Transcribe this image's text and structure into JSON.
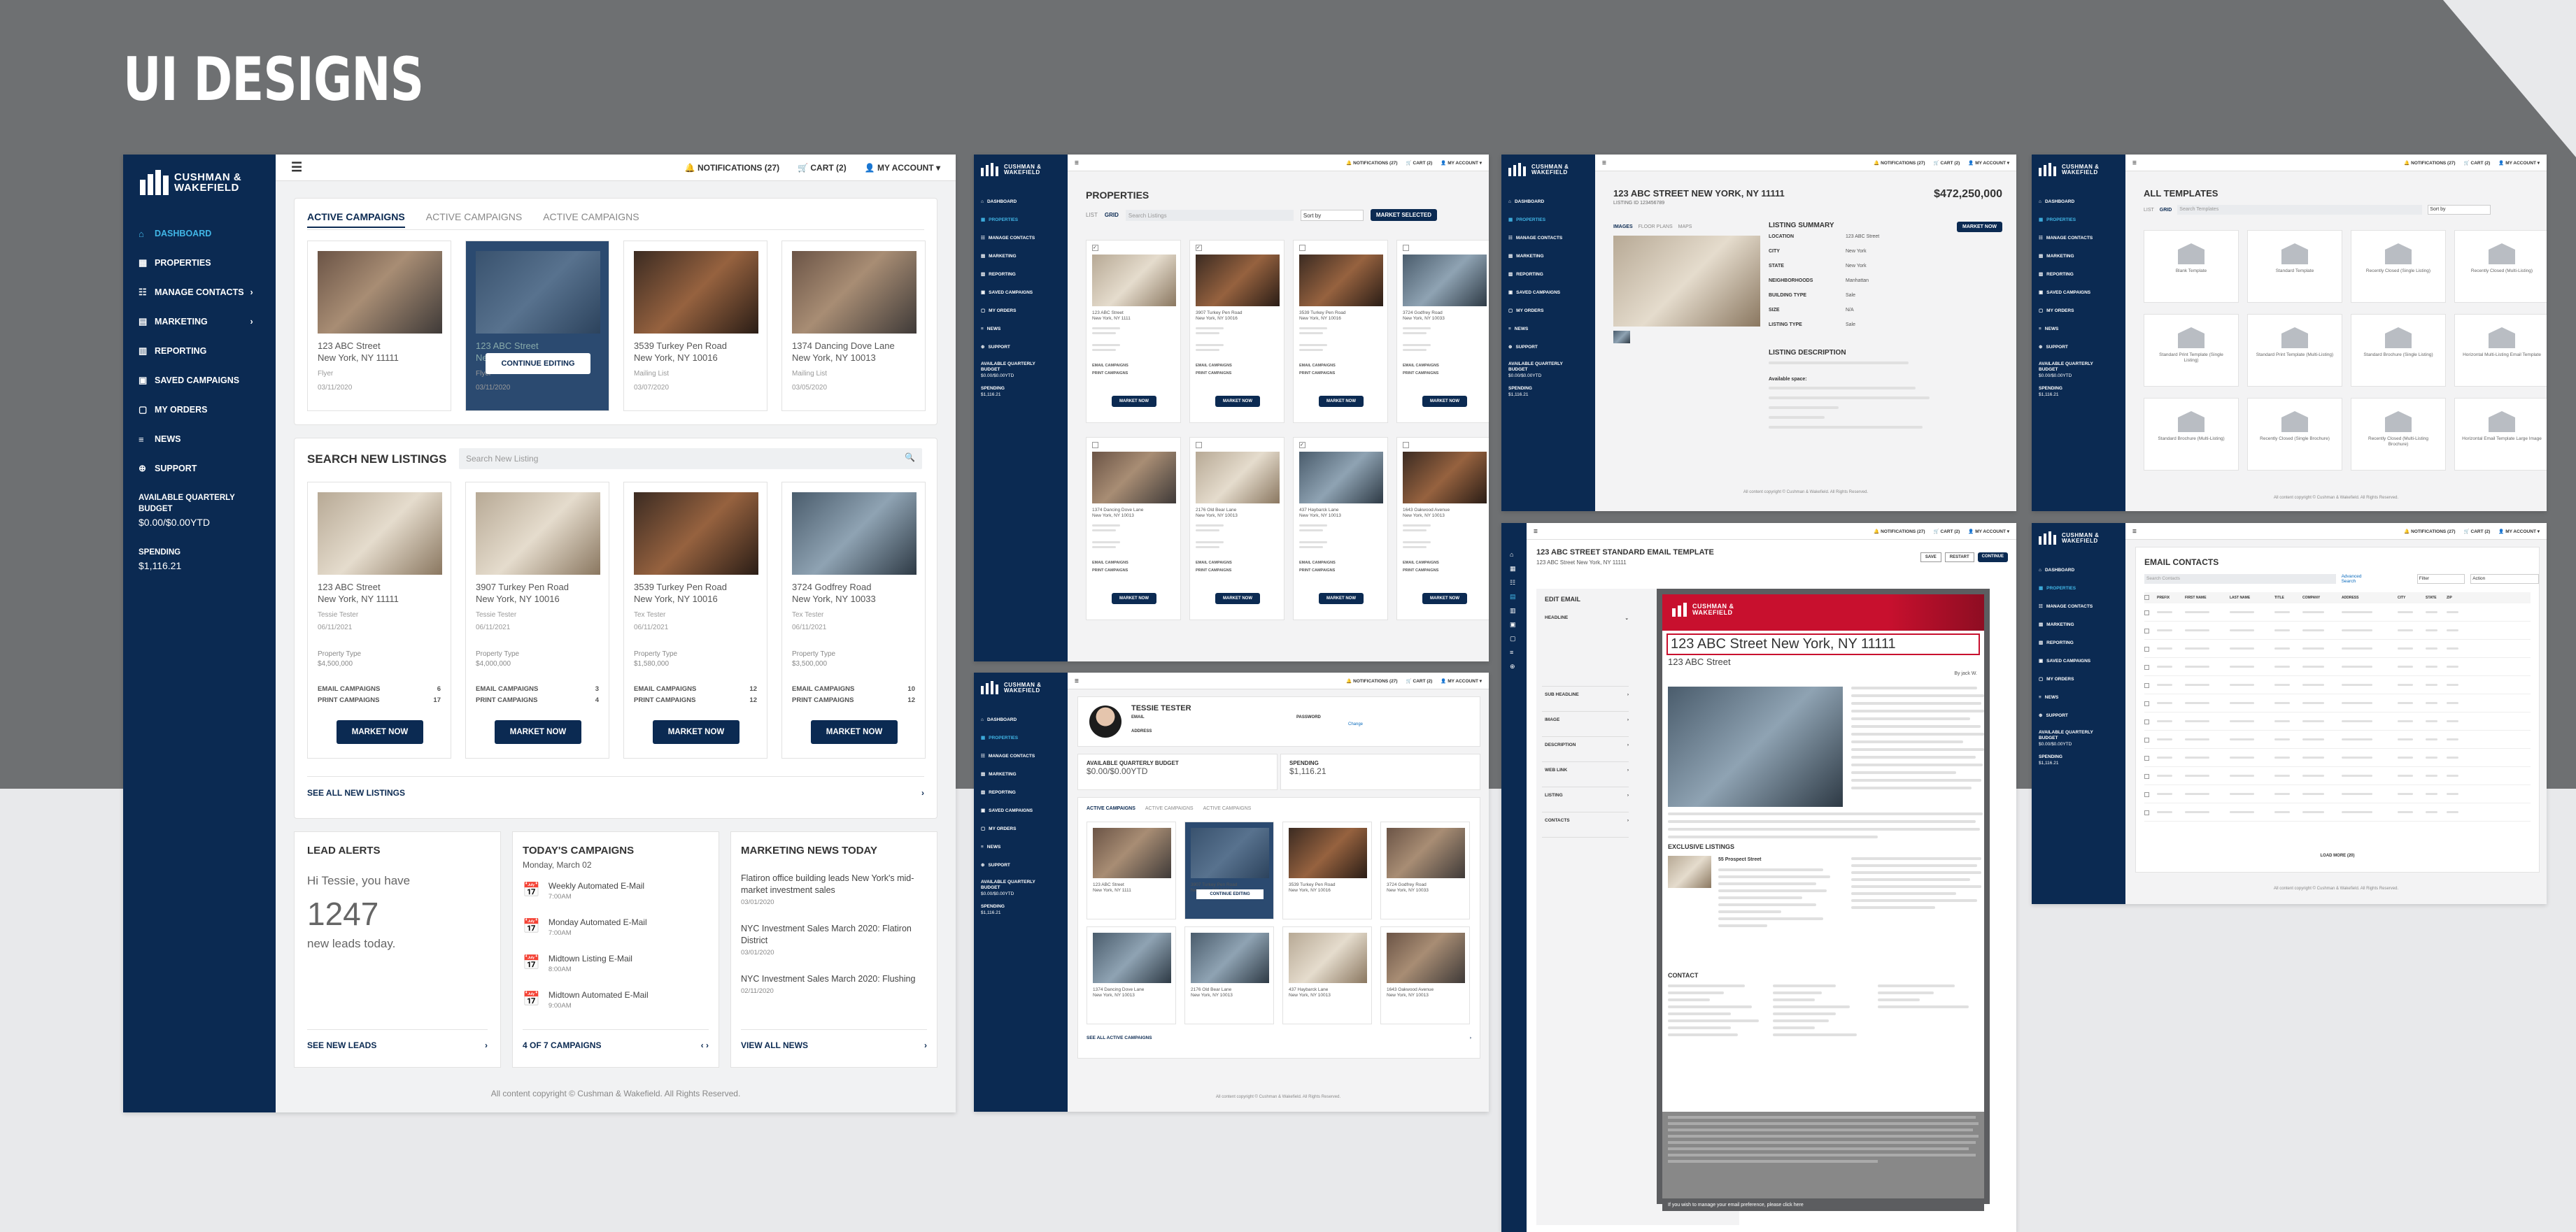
{
  "heading": "UI DESIGNS",
  "brand": {
    "line1": "CUSHMAN &",
    "line2": "WAKEFIELD"
  },
  "nav": [
    "DASHBOARD",
    "PROPERTIES",
    "MANAGE CONTACTS",
    "MARKETING",
    "REPORTING",
    "SAVED CAMPAIGNS",
    "MY ORDERS",
    "NEWS",
    "SUPPORT"
  ],
  "budget": {
    "label1": "AVAILABLE QUARTERLY",
    "label2": "BUDGET",
    "value": "$0.00/$0.00YTD",
    "spending_label": "SPENDING",
    "spending": "$1,116.21"
  },
  "topbar": {
    "notifications": "NOTIFICATIONS (27)",
    "cart": "CART (2)",
    "account": "MY ACCOUNT"
  },
  "dashboard": {
    "tabs": [
      "ACTIVE CAMPAIGNS",
      "ACTIVE CAMPAIGNS",
      "ACTIVE CAMPAIGNS"
    ],
    "campaigns": [
      {
        "addr1": "123 ABC Street",
        "addr2": "New York, NY 11111",
        "type": "Flyer",
        "date": "03/11/2020"
      },
      {
        "addr1": "123 ABC Street",
        "addr2": "New York, NY 11111",
        "type": "Flyer",
        "date": "03/11/2020",
        "overlay": "CONTINUE EDITING"
      },
      {
        "addr1": "3539 Turkey Pen Road",
        "addr2": "New York, NY 10016",
        "type": "Mailing List",
        "date": "03/07/2020"
      },
      {
        "addr1": "1374 Dancing Dove Lane",
        "addr2": "New York, NY 10013",
        "type": "Mailing List",
        "date": "03/05/2020"
      }
    ],
    "search_title": "SEARCH NEW LISTINGS",
    "search_placeholder": "Search New Listing",
    "listings": [
      {
        "addr1": "123 ABC Street",
        "addr2": "New York, NY 11111",
        "agent": "Tessie Tester",
        "date": "06/11/2021",
        "ptype_label": "Property Type",
        "ptype": "$4,500,000",
        "email_label": "EMAIL CAMPAIGNS",
        "email": "6",
        "print_label": "PRINT CAMPAIGNS",
        "print": "17"
      },
      {
        "addr1": "3907 Turkey Pen Road",
        "addr2": "New York, NY 10016",
        "agent": "Tessie Tester",
        "date": "06/11/2021",
        "ptype_label": "Property Type",
        "ptype": "$4,000,000",
        "email_label": "EMAIL CAMPAIGNS",
        "email": "3",
        "print_label": "PRINT CAMPAIGNS",
        "print": "4"
      },
      {
        "addr1": "3539 Turkey Pen Road",
        "addr2": "New York, NY 10016",
        "agent": "Tex Tester",
        "date": "06/11/2021",
        "ptype_label": "Property Type",
        "ptype": "$1,580,000",
        "email_label": "EMAIL CAMPAIGNS",
        "email": "12",
        "print_label": "PRINT CAMPAIGNS",
        "print": "12"
      },
      {
        "addr1": "3724 Godfrey Road",
        "addr2": "New York, NY 10033",
        "agent": "Tex Tester",
        "date": "06/11/2021",
        "ptype_label": "Property Type",
        "ptype": "$3,500,000",
        "email_label": "EMAIL CAMPAIGNS",
        "email": "10",
        "print_label": "PRINT CAMPAIGNS",
        "print": "12"
      }
    ],
    "market_now": "MARKET NOW",
    "see_all": "SEE ALL NEW LISTINGS",
    "lead": {
      "title": "LEAD ALERTS",
      "greet": "Hi Tessie, you have",
      "count": "1247",
      "sub": "new leads today.",
      "link": "SEE NEW LEADS"
    },
    "today": {
      "title": "TODAY'S CAMPAIGNS",
      "date": "Monday, March 02",
      "items": [
        {
          "name": "Weekly Automated E-Mail",
          "time": "7:00AM"
        },
        {
          "name": "Monday Automated E-Mail",
          "time": "7:00AM"
        },
        {
          "name": "Midtown Listing E-Mail",
          "time": "8:00AM"
        },
        {
          "name": "Midtown Automated E-Mail",
          "time": "9:00AM"
        }
      ],
      "pager": "4 OF 7 CAMPAIGNS"
    },
    "news": {
      "title": "MARKETING NEWS TODAY",
      "items": [
        {
          "title": "Flatiron office building leads New York's mid-market investment sales",
          "date": "03/01/2020"
        },
        {
          "title": "NYC Investment Sales March 2020: Flatiron District",
          "date": "03/01/2020"
        },
        {
          "title": "NYC Investment Sales March 2020: Flushing",
          "date": "02/11/2020"
        }
      ],
      "link": "VIEW ALL NEWS"
    },
    "footer": "All content copyright © Cushman & Wakefield. All Rights Reserved."
  },
  "properties": {
    "title": "PROPERTIES",
    "list": "LIST",
    "grid": "GRID",
    "search": "Search Listings",
    "sort": "Sort by",
    "market_selected": "MARKET SELECTED",
    "items": [
      {
        "a": "123 ABC Street",
        "b": "New York, NY 1111"
      },
      {
        "a": "3907 Turkey Pen Road",
        "b": "New York, NY 10016"
      },
      {
        "a": "3539 Turkey Pen Road",
        "b": "New York, NY 10016"
      },
      {
        "a": "3724 Godfrey Road",
        "b": "New York, NY 10033"
      },
      {
        "a": "1374 Dancing Dove Lane",
        "b": "New York, NY 10013"
      },
      {
        "a": "2176 Old Bear Lane",
        "b": "New York, NY 10013"
      },
      {
        "a": "437 Haybarck Lane",
        "b": "New York, NY 10013"
      },
      {
        "a": "1643 Oakwood Avenue",
        "b": "New York, NY 10013"
      }
    ]
  },
  "detail": {
    "title": "123 ABC STREET NEW YORK, NY 11111",
    "listing_id": "LISTING ID 123456789",
    "price": "$472,250,000",
    "tabs": [
      "IMAGES",
      "FLOOR PLANS",
      "MAPS"
    ],
    "summary_title": "LISTING SUMMARY",
    "rows": [
      [
        "LOCATION",
        "123 ABC Street"
      ],
      [
        "CITY",
        "New York"
      ],
      [
        "STATE",
        "New York"
      ],
      [
        "NEIGHBORHOODS",
        "Manhattan"
      ],
      [
        "BUILDING TYPE",
        "Sale"
      ],
      [
        "SIZE",
        "N/A"
      ],
      [
        "LISTING TYPE",
        "Sale"
      ]
    ],
    "desc_title": "LISTING DESCRIPTION",
    "available": "Available space:"
  },
  "templates": {
    "title": "ALL TEMPLATES",
    "search": "Search Templates",
    "sort": "Sort by",
    "items": [
      "Blank Template",
      "Standard Template",
      "Recently Closed (Single Listing)",
      "Recently Closed (Multi-Listing)",
      "Standard Print Template (Single Listing)",
      "Standard Print Template (Multi-Listing)",
      "Standard Brochure (Single Listing)",
      "Horizontal Multi-Listing Email Template",
      "Standard Brochure (Multi-Listing)",
      "Recently Closed (Single Brochure)",
      "Recently Closed (Multi-Listing Brochure)",
      "Horizontal Email Template Large Image"
    ]
  },
  "profile": {
    "name": "TESSIE TESTER",
    "email_label": "EMAIL",
    "password_label": "PASSWORD",
    "change": "Change",
    "address_label": "ADDRESS",
    "budget_label": "AVAILABLE QUARTERLY BUDGET",
    "budget": "$0.00/$0.00YTD",
    "spending_label": "SPENDING",
    "spending": "$1,116.21",
    "see_all": "SEE ALL ACTIVE CAMPAIGNS"
  },
  "email_tpl": {
    "title": "123 ABC STREET STANDARD EMAIL TEMPLATE",
    "sub": "123 ABC Street New York, NY 11111",
    "save": "SAVE",
    "restart": "RESTART",
    "continue": "CONTINUE",
    "edit": "EDIT EMAIL",
    "sections": [
      "HEADLINE",
      "SUB HEADLINE",
      "IMAGE",
      "DESCRIPTION",
      "WEB LINK",
      "LISTING",
      "CONTACTS"
    ],
    "preview_head": "123 ABC Street New York, NY 11111",
    "preview_sub": "123 ABC Street",
    "by": "By jack W.",
    "exclusive": "EXCLUSIVE LISTINGS",
    "prospect": "55 Prospect Street",
    "contact": "CONTACT",
    "manage": "If you wish to manage your email preference, please click here"
  },
  "contacts": {
    "title": "EMAIL CONTACTS",
    "search": "Search Contacts",
    "advanced": "Advanced Search",
    "filter": "Filter",
    "action": "Action",
    "cols": [
      "PREFIX",
      "FIRST NAME",
      "LAST NAME",
      "TITLE",
      "COMPANY",
      "ADDRESS",
      "CITY",
      "STATE",
      "ZIP"
    ],
    "load_more": "LOAD MORE (20)"
  }
}
